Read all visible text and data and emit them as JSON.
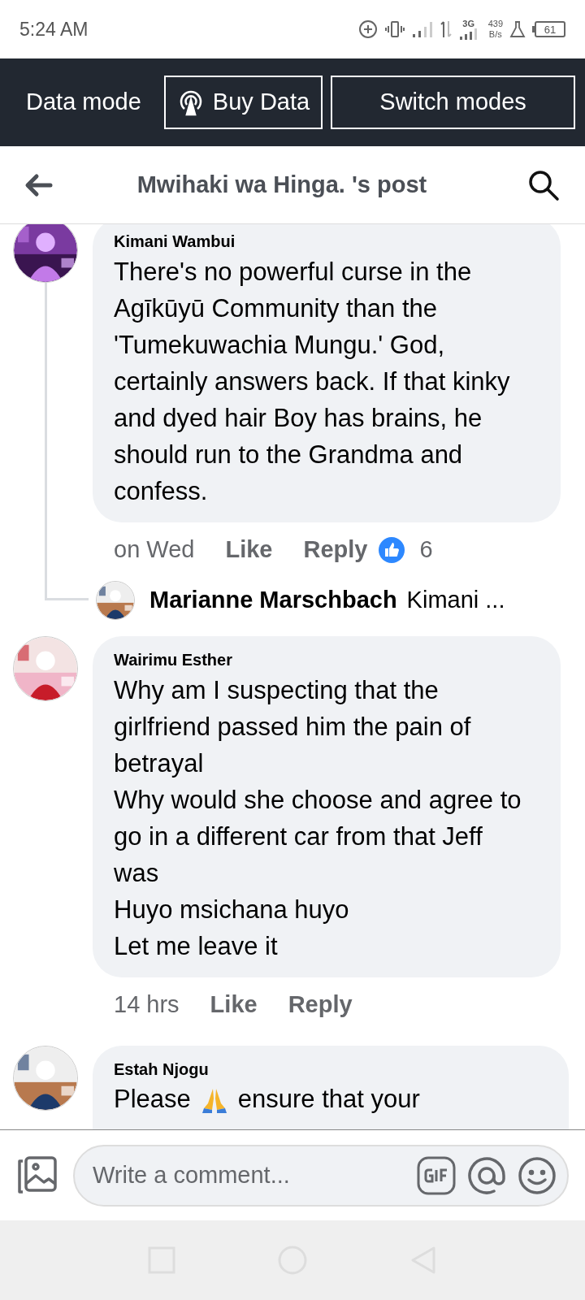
{
  "status_bar": {
    "time": "5:24 AM",
    "network": "3G",
    "speed": "439",
    "speed_unit": "B/s",
    "battery": "61"
  },
  "data_bar": {
    "label": "Data mode",
    "buttons": [
      {
        "label": "Buy Data",
        "kind": "buy"
      },
      {
        "label": "Switch modes",
        "kind": "plain"
      }
    ]
  },
  "header": {
    "title": "Mwihaki wa Hinga. 's post"
  },
  "comments": [
    {
      "author": "Kimani Wambui",
      "text": "There's no powerful curse in the Agīkūyū Community than the 'Tumekuwachia Mungu.' God, certainly answers back. If that kinky and dyed hair Boy has brains, he should run to the Grandma and confess.",
      "time": "on Wed",
      "like": "Like",
      "reply": "Reply",
      "reactions": "6",
      "replies": [
        {
          "author": "Marianne Marschbach",
          "preview": "Kimani ..."
        }
      ]
    },
    {
      "author": "Wairimu Esther",
      "text": "Why am I suspecting that the girlfriend passed him the pain of betrayal\nWhy would she choose and agree to go in a different car from that Jeff was\nHuyo msichana huyo\nLet me leave it",
      "time": "14 hrs",
      "like": "Like",
      "reply": "Reply"
    },
    {
      "author": "Estah Njogu",
      "text_parts": [
        "Please",
        "ensure that your"
      ]
    }
  ],
  "composer": {
    "placeholder": "Write a comment..."
  }
}
